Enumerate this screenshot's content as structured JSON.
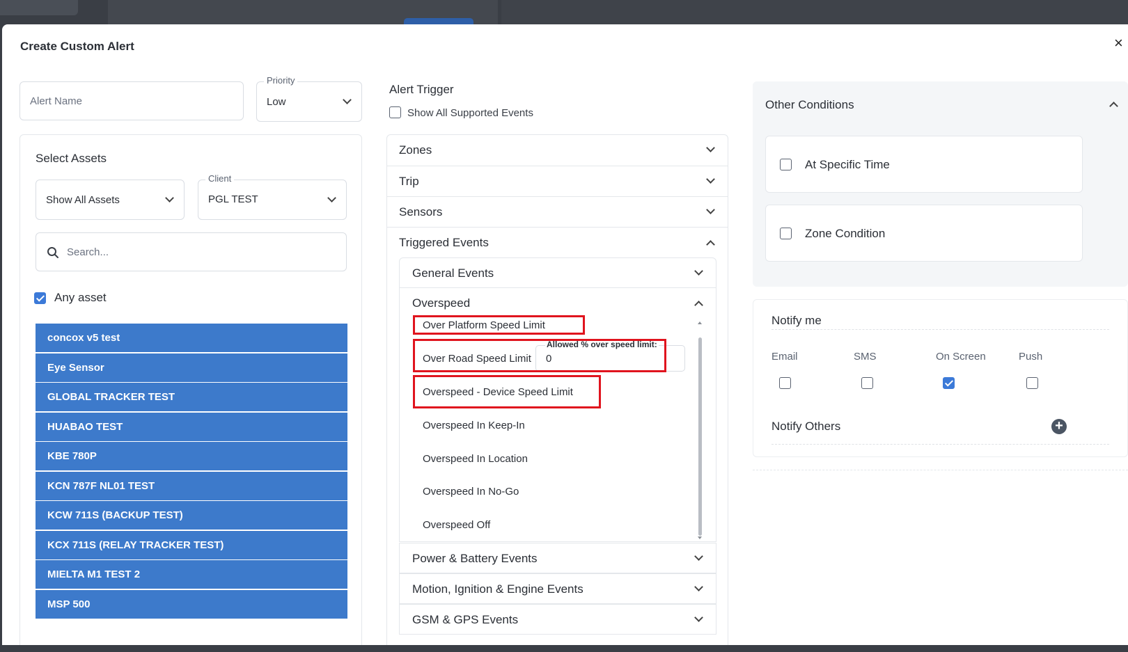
{
  "modal": {
    "title": "Create Custom Alert",
    "close": "×"
  },
  "alert_name": {
    "placeholder": "Alert Name"
  },
  "priority": {
    "label": "Priority",
    "value": "Low"
  },
  "assets": {
    "title": "Select Assets",
    "filter_value": "Show All Assets",
    "client_label": "Client",
    "client_value": "PGL TEST",
    "search_placeholder": "Search...",
    "any_asset_label": "Any asset",
    "items": [
      "concox v5 test",
      "Eye Sensor",
      "GLOBAL TRACKER TEST",
      "HUABAO TEST",
      "KBE 780P",
      "KCN 787F NL01 TEST",
      "KCW 711S (BACKUP TEST)",
      "KCX 711S (RELAY TRACKER TEST)",
      "MIELTA M1 TEST 2",
      "MSP 500"
    ]
  },
  "trigger": {
    "title": "Alert Trigger",
    "show_all_label": "Show All Supported Events",
    "sections": [
      "Zones",
      "Trip",
      "Sensors",
      "Triggered Events"
    ],
    "triggered_subsections": {
      "general": "General Events",
      "overspeed": "Overspeed",
      "power": "Power & Battery Events",
      "motion": "Motion, Ignition & Engine Events",
      "gsm": "GSM & GPS Events"
    },
    "overspeed_events": [
      "Over Platform Speed Limit",
      "Over Road Speed Limit",
      "Overspeed - Device Speed Limit",
      "Overspeed In Keep-In",
      "Overspeed In Location",
      "Overspeed In No-Go",
      "Overspeed Off"
    ],
    "allowed_label": "Allowed % over speed limit:",
    "allowed_value": "0"
  },
  "other_conditions": {
    "title": "Other Conditions",
    "items": [
      "At Specific Time",
      "Zone Condition"
    ]
  },
  "notify": {
    "title": "Notify me",
    "channels": [
      "Email",
      "SMS",
      "On Screen",
      "Push"
    ],
    "others_label": "Notify Others"
  }
}
